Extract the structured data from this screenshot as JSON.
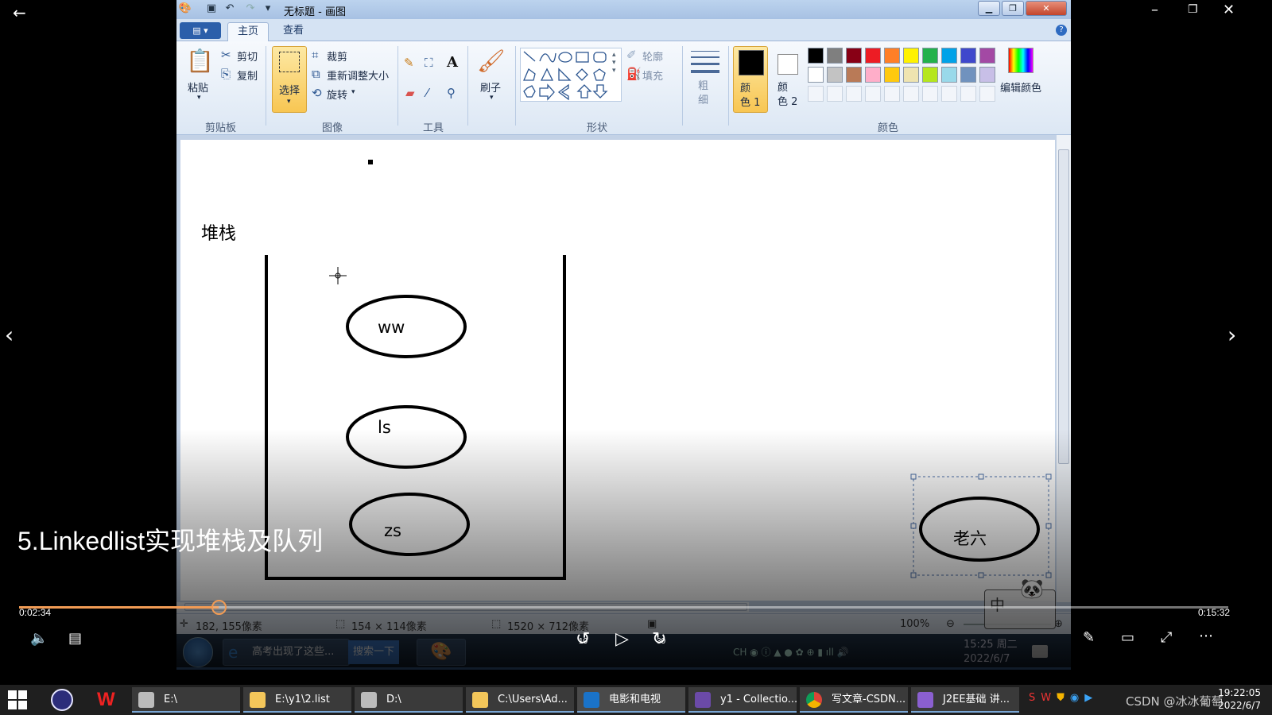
{
  "player": {
    "video_title": "5.Linkedlist实现堆栈及队列",
    "current_time": "0:02:34",
    "total_time": "0:15:32",
    "progress": 0.1652,
    "skip_back_label": "10",
    "skip_forward_label": "30"
  },
  "paint": {
    "window_title": "无标题 - 画图",
    "tabs": [
      "主页",
      "查看"
    ],
    "ribbon": {
      "clipboard": {
        "paste": "粘贴",
        "cut": "剪切",
        "copy": "复制",
        "group": "剪贴板"
      },
      "image": {
        "select": "选择",
        "crop": "裁剪",
        "resize": "重新调整大小",
        "rotate": "旋转",
        "group": "图像"
      },
      "tools": {
        "group": "工具"
      },
      "brush": "刷子",
      "shapes": {
        "outline": "轮廓",
        "fill": "填充",
        "group": "形状"
      },
      "size": "粗\n细",
      "color1": "颜\n色 1",
      "color2": "颜\n色 2",
      "edit_colors": "编辑颜色",
      "colors_group": "颜色"
    },
    "palette_row1": [
      "#000000",
      "#7f7f7f",
      "#880015",
      "#ed1c24",
      "#ff7f27",
      "#fff200",
      "#22b14c",
      "#00a2e8",
      "#3f48cc",
      "#a349a4"
    ],
    "palette_row2": [
      "#ffffff",
      "#c3c3c3",
      "#b97a57",
      "#ffaec9",
      "#ffc90e",
      "#efe4b0",
      "#b5e61d",
      "#99d9ea",
      "#7092be",
      "#c8bfe7"
    ],
    "canvas": {
      "heading": "堆栈",
      "items": [
        "ww",
        "ls",
        "zs"
      ],
      "pending_item": "老六"
    },
    "status": {
      "cursor": "182, 155像素",
      "selection": "154 × 114像素",
      "image_size": "1520 × 712像素",
      "zoom": "100%"
    }
  },
  "vm_taskbar": {
    "tasks": [
      "高考出现了这些...",
      "搜索一下"
    ],
    "ime": "中",
    "tray_time": "15:25 周二",
    "tray_date": "2022/6/7"
  },
  "host_taskbar": {
    "tasks": [
      "E:\\",
      "E:\\y1\\2.list",
      "D:\\",
      "C:\\Users\\Ad...",
      "电影和电视",
      "y1 - Collectio...",
      "写文章-CSDN...",
      "J2EE基础 讲..."
    ],
    "time": "19:22:05",
    "date": "2022/6/7",
    "watermark": "CSDN @冰冰葡萄"
  }
}
